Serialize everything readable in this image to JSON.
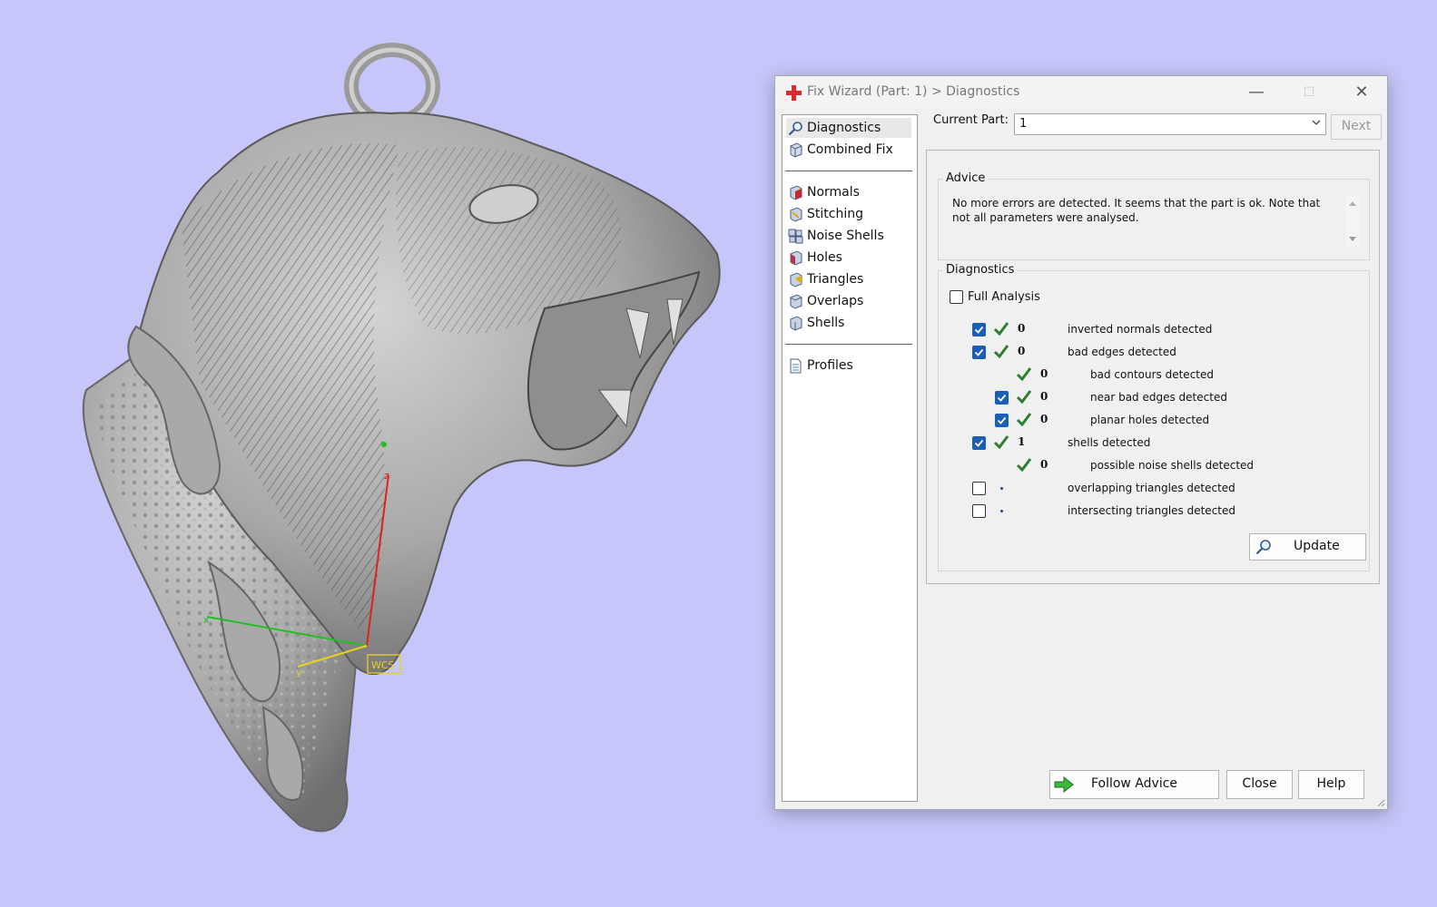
{
  "window": {
    "title": "Fix Wizard (Part: 1) > Diagnostics",
    "controls": [
      "minimize",
      "maximize",
      "close"
    ]
  },
  "viewport": {
    "axes": {
      "x_label": "x",
      "y_label": "y",
      "z_label": "z",
      "wcs_label": "WCS"
    }
  },
  "nav": {
    "top": [
      {
        "label": "Diagnostics",
        "icon": "magnifier-icon",
        "selected": true
      },
      {
        "label": "Combined Fix",
        "icon": "cube-icon"
      }
    ],
    "tools": [
      {
        "label": "Normals",
        "icon": "normals-cube-icon"
      },
      {
        "label": "Stitching",
        "icon": "stitching-cube-icon"
      },
      {
        "label": "Noise Shells",
        "icon": "noise-shells-icon"
      },
      {
        "label": "Holes",
        "icon": "holes-cube-icon"
      },
      {
        "label": "Triangles",
        "icon": "triangles-cube-icon"
      },
      {
        "label": "Overlaps",
        "icon": "overlaps-cube-icon"
      },
      {
        "label": "Shells",
        "icon": "shells-cube-icon"
      }
    ],
    "bottom": [
      {
        "label": "Profiles",
        "icon": "document-icon"
      }
    ]
  },
  "current_part": {
    "label": "Current Part:",
    "value": "1"
  },
  "next_label": "Next",
  "advice": {
    "title": "Advice",
    "text": "No more errors are detected. It seems that the part is ok. Note that not all parameters were analysed."
  },
  "diagnostics": {
    "title": "Diagnostics",
    "full_analysis": {
      "label": "Full Analysis",
      "checked": false
    },
    "rows": [
      {
        "checkbox": true,
        "checked": true,
        "status": "ok",
        "count": "0",
        "label": "inverted normals detected",
        "indent": 0
      },
      {
        "checkbox": true,
        "checked": true,
        "status": "ok",
        "count": "0",
        "label": "bad edges detected",
        "indent": 0
      },
      {
        "checkbox": false,
        "checked": false,
        "status": "ok",
        "count": "0",
        "label": "bad contours detected",
        "indent": 1
      },
      {
        "checkbox": true,
        "checked": true,
        "status": "ok",
        "count": "0",
        "label": "near bad edges detected",
        "indent": 1
      },
      {
        "checkbox": true,
        "checked": true,
        "status": "ok",
        "count": "0",
        "label": "planar holes detected",
        "indent": 1
      },
      {
        "checkbox": true,
        "checked": true,
        "status": "ok",
        "count": "1",
        "label": "shells detected",
        "indent": 0
      },
      {
        "checkbox": false,
        "checked": false,
        "status": "ok",
        "count": "0",
        "label": "possible noise shells detected",
        "indent": 1
      },
      {
        "checkbox": true,
        "checked": false,
        "status": "none",
        "count": "",
        "label": "overlapping triangles detected",
        "indent": 0
      },
      {
        "checkbox": true,
        "checked": false,
        "status": "none",
        "count": "",
        "label": "intersecting triangles detected",
        "indent": 0
      }
    ],
    "update_label": "Update"
  },
  "buttons": {
    "follow_advice": "Follow Advice",
    "close": "Close",
    "help": "Help"
  },
  "colors": {
    "background": "#c6c6fa",
    "checkbox_checked": "#1a5fb4",
    "ok_tick": "#2e7d32",
    "title_icon": "#d32f2f"
  }
}
